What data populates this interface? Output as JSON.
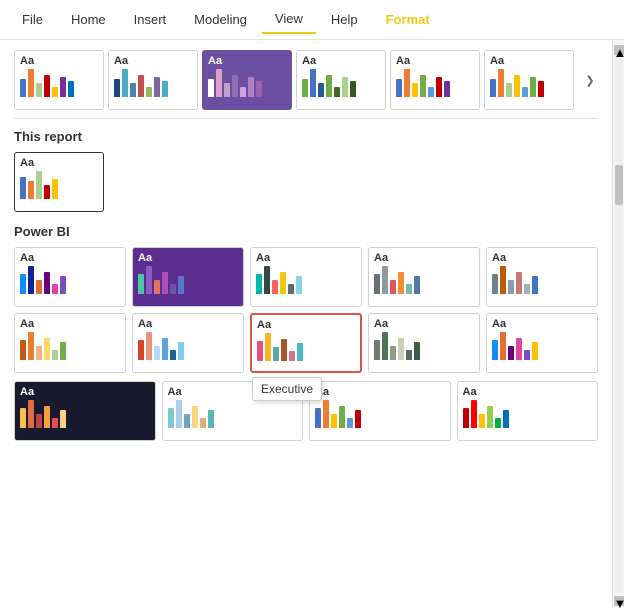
{
  "menuBar": {
    "items": [
      {
        "label": "File",
        "active": false
      },
      {
        "label": "Home",
        "active": false
      },
      {
        "label": "Insert",
        "active": false
      },
      {
        "label": "Modeling",
        "active": false
      },
      {
        "label": "View",
        "active": true
      },
      {
        "label": "Help",
        "active": false
      },
      {
        "label": "Format",
        "active": false,
        "special": true
      }
    ]
  },
  "sections": {
    "thisReport": "This report",
    "powerBI": "Power BI"
  },
  "tooltip": {
    "label": "Executive"
  },
  "topRowThemes": [
    {
      "id": "top1",
      "bars": [
        {
          "color": "#4472c4",
          "h": 18
        },
        {
          "color": "#ed7d31",
          "h": 28
        },
        {
          "color": "#a9d18e",
          "h": 14
        },
        {
          "color": "#c00000",
          "h": 22
        },
        {
          "color": "#ffc000",
          "h": 10
        },
        {
          "color": "#7030a0",
          "h": 20
        },
        {
          "color": "#0070c0",
          "h": 16
        }
      ],
      "selected": false,
      "dark": false
    },
    {
      "id": "top2",
      "bars": [
        {
          "color": "#1f497d",
          "h": 18
        },
        {
          "color": "#4aacc5",
          "h": 28
        },
        {
          "color": "#4f81bd",
          "h": 14
        },
        {
          "color": "#c0504d",
          "h": 22
        },
        {
          "color": "#9bbb59",
          "h": 10
        },
        {
          "color": "#8064a2",
          "h": 20
        },
        {
          "color": "#4bacc6",
          "h": 16
        }
      ],
      "selected": false,
      "dark": false
    },
    {
      "id": "top3",
      "bars": [
        {
          "color": "#fff",
          "h": 18
        },
        {
          "color": "#e0a1c8",
          "h": 28
        },
        {
          "color": "#c0a0d0",
          "h": 14
        },
        {
          "color": "#9070b0",
          "h": 22
        },
        {
          "color": "#d0a0e0",
          "h": 10
        },
        {
          "color": "#b080c0",
          "h": 20
        },
        {
          "color": "#a060b0",
          "h": 16
        }
      ],
      "selected": true,
      "dark": true
    },
    {
      "id": "top4",
      "bars": [
        {
          "color": "#70ad47",
          "h": 18
        },
        {
          "color": "#4472c4",
          "h": 28
        },
        {
          "color": "#255e91",
          "h": 14
        },
        {
          "color": "#70ad47",
          "h": 22
        },
        {
          "color": "#44682b",
          "h": 10
        },
        {
          "color": "#a9d18e",
          "h": 20
        },
        {
          "color": "#375623",
          "h": 16
        }
      ],
      "selected": false,
      "dark": false
    },
    {
      "id": "top5",
      "bars": [
        {
          "color": "#4472c4",
          "h": 18
        },
        {
          "color": "#ed7d31",
          "h": 28
        },
        {
          "color": "#ffc000",
          "h": 14
        },
        {
          "color": "#70ad47",
          "h": 22
        },
        {
          "color": "#5b9bd5",
          "h": 10
        },
        {
          "color": "#c00000",
          "h": 20
        },
        {
          "color": "#7030a0",
          "h": 16
        }
      ],
      "selected": false,
      "dark": false
    },
    {
      "id": "top6",
      "bars": [
        {
          "color": "#4472c4",
          "h": 18
        },
        {
          "color": "#ed7d31",
          "h": 28
        },
        {
          "color": "#a9d18e",
          "h": 14
        },
        {
          "color": "#ffc000",
          "h": 22
        },
        {
          "color": "#5b9bd5",
          "h": 10
        },
        {
          "color": "#70ad47",
          "h": 20
        },
        {
          "color": "#c00000",
          "h": 16
        }
      ],
      "selected": false,
      "dark": false
    }
  ],
  "thisReportTheme": {
    "bars": [
      {
        "color": "#4472c4",
        "h": 22
      },
      {
        "color": "#ed7d31",
        "h": 18
      },
      {
        "color": "#a9d18e",
        "h": 28
      },
      {
        "color": "#c00000",
        "h": 14
      },
      {
        "color": "#ffc000",
        "h": 20
      }
    ]
  },
  "powerBIThemes": [
    {
      "id": "pbi1",
      "dark": false,
      "highlighted": false,
      "bars": [
        {
          "color": "#118dff",
          "h": 20
        },
        {
          "color": "#12239e",
          "h": 28
        },
        {
          "color": "#e66c37",
          "h": 14
        },
        {
          "color": "#6b007b",
          "h": 22
        },
        {
          "color": "#e044a7",
          "h": 10
        },
        {
          "color": "#744ec2",
          "h": 18
        }
      ]
    },
    {
      "id": "pbi2",
      "dark": false,
      "highlighted": false,
      "bars": [
        {
          "color": "#4bc6a8",
          "h": 20
        },
        {
          "color": "#8b5dc2",
          "h": 28
        },
        {
          "color": "#e5745b",
          "h": 14
        },
        {
          "color": "#ae4ebc",
          "h": 22
        },
        {
          "color": "#7054a2",
          "h": 10
        },
        {
          "color": "#5578cc",
          "h": 18
        }
      ],
      "bg": "#5c2d91"
    },
    {
      "id": "pbi3",
      "dark": false,
      "highlighted": false,
      "bars": [
        {
          "color": "#01b8aa",
          "h": 20
        },
        {
          "color": "#374649",
          "h": 28
        },
        {
          "color": "#fd625e",
          "h": 14
        },
        {
          "color": "#f2c80f",
          "h": 22
        },
        {
          "color": "#5f6b6d",
          "h": 10
        },
        {
          "color": "#8ad4eb",
          "h": 18
        }
      ]
    },
    {
      "id": "pbi4",
      "dark": false,
      "highlighted": false,
      "bars": [
        {
          "color": "#637074",
          "h": 20
        },
        {
          "color": "#8c9b9d",
          "h": 28
        },
        {
          "color": "#e15759",
          "h": 14
        },
        {
          "color": "#f28e2b",
          "h": 22
        },
        {
          "color": "#76b7b2",
          "h": 10
        },
        {
          "color": "#4e79a7",
          "h": 18
        }
      ]
    },
    {
      "id": "pbi5",
      "dark": false,
      "highlighted": false,
      "bars": [
        {
          "color": "#6e7f8d",
          "h": 20
        },
        {
          "color": "#c05805",
          "h": 28
        },
        {
          "color": "#8b9bab",
          "h": 14
        },
        {
          "color": "#c8786e",
          "h": 22
        },
        {
          "color": "#a0b0be",
          "h": 10
        },
        {
          "color": "#4472c4",
          "h": 18
        }
      ]
    },
    {
      "id": "pbi6",
      "dark": false,
      "highlighted": false,
      "bars": [
        {
          "color": "#c55a11",
          "h": 20
        },
        {
          "color": "#ed7d31",
          "h": 28
        },
        {
          "color": "#f4b183",
          "h": 14
        },
        {
          "color": "#ffd966",
          "h": 22
        },
        {
          "color": "#a9d18e",
          "h": 10
        },
        {
          "color": "#70ad47",
          "h": 18
        }
      ]
    },
    {
      "id": "pbi7",
      "dark": false,
      "highlighted": false,
      "bars": [
        {
          "color": "#d24726",
          "h": 20
        },
        {
          "color": "#e8957b",
          "h": 28
        },
        {
          "color": "#b5d9f7",
          "h": 14
        },
        {
          "color": "#5ba3e0",
          "h": 22
        },
        {
          "color": "#225f91",
          "h": 10
        },
        {
          "color": "#7ecef4",
          "h": 18
        }
      ]
    },
    {
      "id": "pbi8",
      "dark": false,
      "highlighted": true,
      "bars": [
        {
          "color": "#e84d8a",
          "h": 20
        },
        {
          "color": "#feb326",
          "h": 28
        },
        {
          "color": "#5ba6a7",
          "h": 14
        },
        {
          "color": "#a65628",
          "h": 22
        },
        {
          "color": "#d67195",
          "h": 10
        },
        {
          "color": "#48b9c7",
          "h": 18
        }
      ]
    },
    {
      "id": "pbi9",
      "dark": false,
      "highlighted": false,
      "bars": [
        {
          "color": "#6b7c6e",
          "h": 20
        },
        {
          "color": "#4d7358",
          "h": 28
        },
        {
          "color": "#8f9f7e",
          "h": 14
        },
        {
          "color": "#c9d0b5",
          "h": 22
        },
        {
          "color": "#516d59",
          "h": 10
        },
        {
          "color": "#3a5c45",
          "h": 18
        }
      ]
    },
    {
      "id": "pbi10",
      "dark": false,
      "highlighted": false,
      "bars": [
        {
          "color": "#118dff",
          "h": 20
        },
        {
          "color": "#e66c37",
          "h": 28
        },
        {
          "color": "#6b007b",
          "h": 14
        },
        {
          "color": "#e044a7",
          "h": 22
        },
        {
          "color": "#744ec2",
          "h": 10
        },
        {
          "color": "#ffc000",
          "h": 18
        }
      ]
    },
    {
      "id": "pbi11",
      "dark": true,
      "highlighted": false,
      "bars": [
        {
          "color": "#f7c14b",
          "h": 20
        },
        {
          "color": "#e06e3e",
          "h": 28
        },
        {
          "color": "#c94044",
          "h": 14
        },
        {
          "color": "#f7a03d",
          "h": 22
        },
        {
          "color": "#e84e53",
          "h": 10
        },
        {
          "color": "#fcd086",
          "h": 18
        }
      ],
      "bg": "#1a1a2e"
    },
    {
      "id": "pbi12",
      "dark": false,
      "highlighted": false,
      "bars": [
        {
          "color": "#7ecbcf",
          "h": 20
        },
        {
          "color": "#a8d0e6",
          "h": 28
        },
        {
          "color": "#6fa3c5",
          "h": 14
        },
        {
          "color": "#f9d57b",
          "h": 22
        },
        {
          "color": "#e8a975",
          "h": 10
        },
        {
          "color": "#5bb6ba",
          "h": 18
        }
      ]
    },
    {
      "id": "pbi13",
      "dark": false,
      "highlighted": false,
      "bars": [
        {
          "color": "#4472c4",
          "h": 20
        },
        {
          "color": "#ed7d31",
          "h": 28
        },
        {
          "color": "#ffc000",
          "h": 14
        },
        {
          "color": "#70ad47",
          "h": 22
        },
        {
          "color": "#5b9bd5",
          "h": 10
        },
        {
          "color": "#c00000",
          "h": 18
        }
      ]
    },
    {
      "id": "pbi14",
      "dark": false,
      "highlighted": false,
      "bars": [
        {
          "color": "#c00000",
          "h": 20
        },
        {
          "color": "#ff0000",
          "h": 28
        },
        {
          "color": "#ffc000",
          "h": 14
        },
        {
          "color": "#92d050",
          "h": 22
        },
        {
          "color": "#00b050",
          "h": 10
        },
        {
          "color": "#0070c0",
          "h": 18
        }
      ]
    }
  ]
}
